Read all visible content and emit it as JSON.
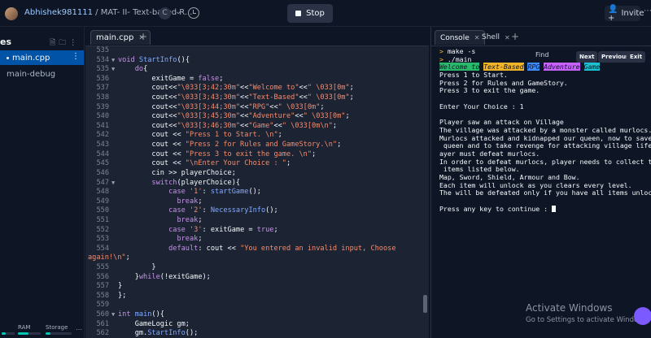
{
  "topbar": {
    "username": "Abhishek981111",
    "separator": " / ",
    "repl_name": "MAT- II- Text-based R...",
    "lang_badge": "C",
    "stop_label": "Stop",
    "invite_label": "Invite"
  },
  "sidebar": {
    "title": "es",
    "files": [
      {
        "name": "main.cpp",
        "active": true
      },
      {
        "name": "main-debug",
        "active": false
      }
    ],
    "resources": [
      {
        "label": "",
        "level": 0.3
      },
      {
        "label": "RAM",
        "level": 0.45
      },
      {
        "label": "Storage",
        "level": 0.2
      }
    ]
  },
  "editor": {
    "tab_label": "main.cpp",
    "lines": [
      {
        "n": "535",
        "fold": "",
        "html": ""
      },
      {
        "n": "534",
        "fold": "▼",
        "html": "<span class='kw'>void</span> <span class='fn'>StartInfo</span>(){"
      },
      {
        "n": "535",
        "fold": "▼",
        "html": "    <span class='kw'>do</span>{"
      },
      {
        "n": "536",
        "fold": "",
        "html": "        exitGame = <span class='kw'>false</span>;"
      },
      {
        "n": "537",
        "fold": "",
        "html": "        cout&lt;&lt;<span class='str'>\"\\033[3;42;30m\"</span>&lt;&lt;<span class='str'>\"Welcome to\"</span>&lt;&lt;<span class='str'>\" \\033[0m\"</span>;"
      },
      {
        "n": "538",
        "fold": "",
        "html": "        cout&lt;&lt;<span class='str'>\"\\033[3;43;30m\"</span>&lt;&lt;<span class='str'>\"Text-Based\"</span>&lt;&lt;<span class='str'>\" \\033[0m\"</span>;"
      },
      {
        "n": "539",
        "fold": "",
        "html": "        cout&lt;&lt;<span class='str'>\"\\033[3;44;30m\"</span>&lt;&lt;<span class='str'>\"RPG\"</span>&lt;&lt;<span class='str'>\" \\033[0m\"</span>;"
      },
      {
        "n": "540",
        "fold": "",
        "html": "        cout&lt;&lt;<span class='str'>\"\\033[3;45;30m\"</span>&lt;&lt;<span class='str'>\"Adventure\"</span>&lt;&lt;<span class='str'>\" \\033[0m\"</span>;"
      },
      {
        "n": "541",
        "fold": "",
        "html": "        cout&lt;&lt;<span class='str'>\"\\033[3;46;30m\"</span>&lt;&lt;<span class='str'>\"Game\"</span>&lt;&lt;<span class='str'>\" \\033[0m\\n\"</span>;"
      },
      {
        "n": "542",
        "fold": "",
        "html": "        cout &lt;&lt; <span class='str'>\"Press 1 to Start. \\n\"</span>;"
      },
      {
        "n": "543",
        "fold": "",
        "html": "        cout &lt;&lt; <span class='str'>\"Press 2 for Rules and GameStory.\\n\"</span>;"
      },
      {
        "n": "544",
        "fold": "",
        "html": "        cout &lt;&lt; <span class='str'>\"Press 3 to exit the game. \\n\"</span>;"
      },
      {
        "n": "545",
        "fold": "",
        "html": "        cout &lt;&lt; <span class='str'>\"\\nEnter Your Choice : \"</span>;"
      },
      {
        "n": "546",
        "fold": "",
        "html": "        cin &gt;&gt; playerChoice;"
      },
      {
        "n": "547",
        "fold": "▼",
        "html": "        <span class='kw'>switch</span>(playerChoice){"
      },
      {
        "n": "548",
        "fold": "",
        "html": "            <span class='kw'>case</span> <span class='str'>'1'</span>: <span class='fn'>startGame</span>();"
      },
      {
        "n": "549",
        "fold": "",
        "html": "              <span class='kw'>break</span>;"
      },
      {
        "n": "550",
        "fold": "",
        "html": "            <span class='kw'>case</span> <span class='str'>'2'</span>: <span class='fn'>NecessaryInfo</span>();"
      },
      {
        "n": "551",
        "fold": "",
        "html": "              <span class='kw'>break</span>;"
      },
      {
        "n": "552",
        "fold": "",
        "html": "            <span class='kw'>case</span> <span class='str'>'3'</span>: exitGame = <span class='kw'>true</span>;"
      },
      {
        "n": "553",
        "fold": "",
        "html": "              <span class='kw'>break</span>;"
      },
      {
        "n": "554",
        "fold": "",
        "html": "            <span class='kw'>default</span>: cout &lt;&lt; <span class='str'>\"You entered an invalid input, Choose</span>"
      },
      {
        "n": "",
        "fold": "",
        "html": "<span class='str'>again!\\n\"</span>;",
        "wrap": true
      },
      {
        "n": "555",
        "fold": "",
        "html": "        }"
      },
      {
        "n": "556",
        "fold": "",
        "html": "    }<span class='kw'>while</span>(!exitGame);"
      },
      {
        "n": "557",
        "fold": "",
        "html": "}"
      },
      {
        "n": "558",
        "fold": "",
        "html": "};"
      },
      {
        "n": "559",
        "fold": "",
        "html": ""
      },
      {
        "n": "560",
        "fold": "▼",
        "html": "<span class='kw'>int</span> <span class='fn'>main</span>(){"
      },
      {
        "n": "561",
        "fold": "",
        "html": "    GameLogic gm;"
      },
      {
        "n": "562",
        "fold": "",
        "html": "    gm.<span class='fn'>StartInfo</span>();"
      }
    ]
  },
  "console": {
    "tabs": [
      {
        "label": "Console"
      },
      {
        "label": "Shell"
      }
    ],
    "find_label": "Find",
    "next_label": "Next",
    "previous_label": "Previous",
    "exit_label": "Exit",
    "output_lines": [
      "> make -s",
      "> ./main",
      "__BANNER__",
      "Press 1 to Start.",
      "Press 2 for Rules and GameStory.",
      "Press 3 to exit the game.",
      "",
      "Enter Your Choice : 1",
      "",
      "Player saw an attack on Village",
      "The village was attacked by a monster called murlocs. :(",
      "Murlocs attacked and kidnapped our queen, now to save the",
      " queen and to take revenge for attacking village life, pl",
      "ayer must defeat murlocs.",
      "In order to defeat murlocs, player needs to collect the 5",
      " items listed below.",
      "Map, Sword, Shield, Armour and Bow.",
      "Each item will unlock as you clears every level.",
      "The will be defeated only if you have all items unlocked.",
      "",
      "Press any key to continue : "
    ],
    "banner": [
      "Welcome to",
      "Text-Based",
      "RPG",
      "Adventure",
      "Game"
    ]
  },
  "watermark": {
    "line1": "Activate Windows",
    "line2": "Go to Settings to activate Windows."
  }
}
